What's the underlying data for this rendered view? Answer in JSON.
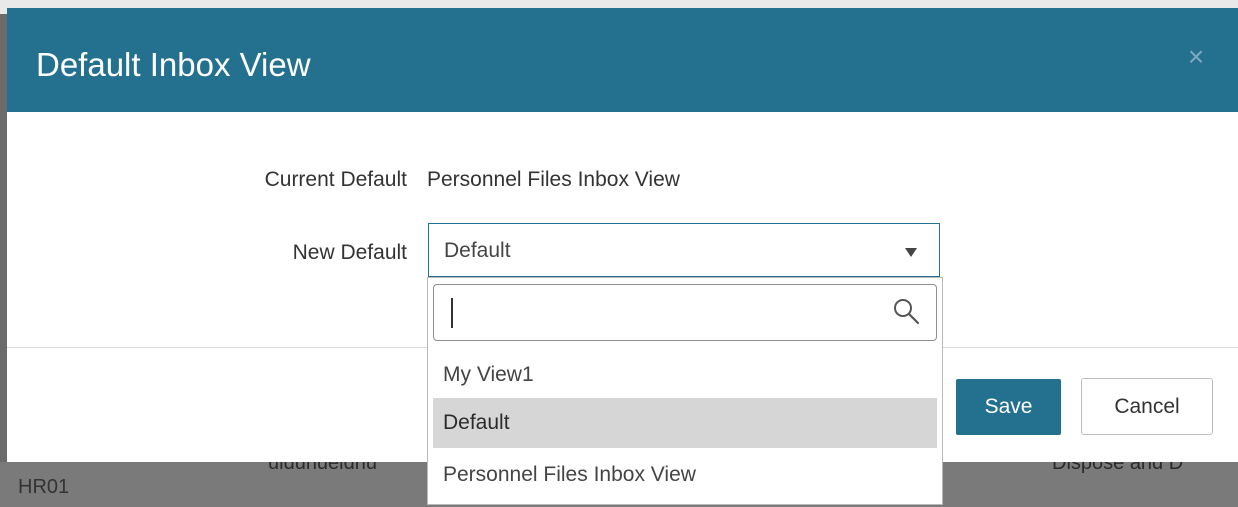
{
  "background": {
    "row_code": "HR01",
    "row_partial_middle": "uldunueidnu",
    "row_partial_right": "Dispose and D"
  },
  "modal": {
    "title": "Default Inbox View",
    "close_glyph": "×",
    "current_default_label": "Current Default",
    "current_default_value": "Personnel Files Inbox View",
    "new_default_label": "New Default",
    "new_default_selected": "Default",
    "save_label": "Save",
    "cancel_label": "Cancel"
  },
  "dropdown": {
    "search_value": "",
    "options": [
      "My View1",
      "Default",
      "Personnel Files Inbox View"
    ],
    "highlighted_option": "Default"
  },
  "icons": {
    "search": "search-icon",
    "select_arrow": "caret-down-icon",
    "close": "close-icon"
  },
  "colors": {
    "header": "#24708f",
    "primary_button": "#24708f",
    "highlight_option": "#d6d6d6"
  }
}
